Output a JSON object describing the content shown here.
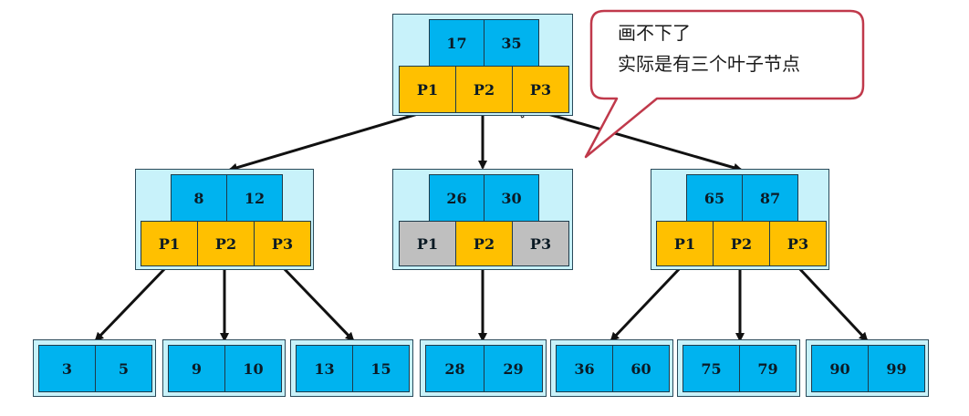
{
  "root": {
    "keys": [
      "17",
      "35"
    ],
    "pointers": [
      "P1",
      "P2",
      "P3"
    ]
  },
  "internal": [
    {
      "keys": [
        "8",
        "12"
      ],
      "pointers": [
        "P1",
        "P2",
        "P3"
      ]
    },
    {
      "keys": [
        "26",
        "30"
      ],
      "pointers": [
        "P1",
        "P2",
        "P3"
      ]
    },
    {
      "keys": [
        "65",
        "87"
      ],
      "pointers": [
        "P1",
        "P2",
        "P3"
      ]
    }
  ],
  "leaves": [
    [
      "3",
      "5"
    ],
    [
      "9",
      "10"
    ],
    [
      "13",
      "15"
    ],
    [
      "28",
      "29"
    ],
    [
      "36",
      "60"
    ],
    [
      "75",
      "79"
    ],
    [
      "90",
      "99"
    ]
  ],
  "callout": {
    "line1": "画不下了",
    "line2": "实际是有三个叶子节点"
  },
  "colors": {
    "key": "#00b3ef",
    "pointer": "#ffc000",
    "pointer_unused": "#bfbfbf",
    "node_bg": "#c8f2fa",
    "callout_border": "#c0394b"
  }
}
